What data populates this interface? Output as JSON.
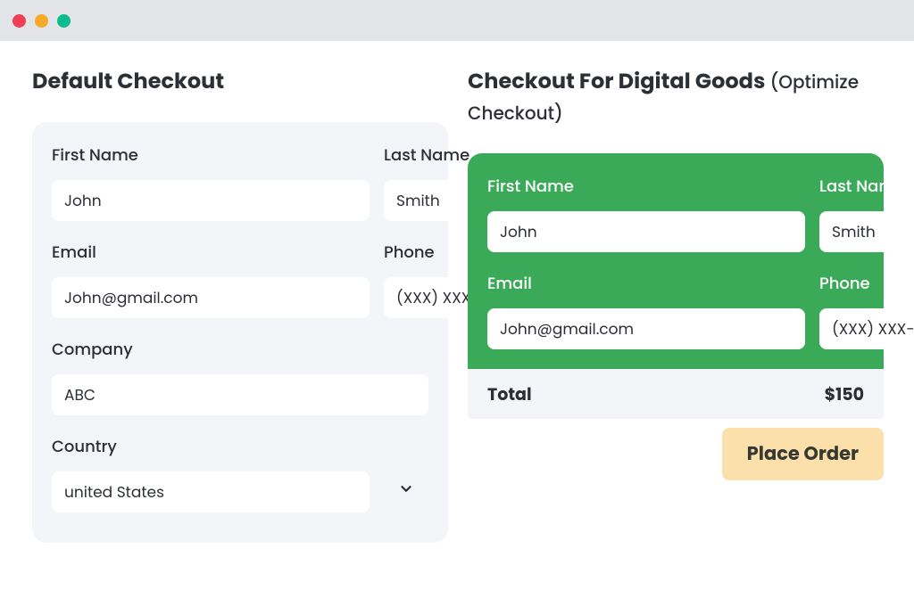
{
  "window": {
    "colors": {
      "red": "#f03e55",
      "yellow": "#f9a828",
      "green": "#0dbc8e"
    }
  },
  "left": {
    "title": "Default Checkout",
    "fields": {
      "first_name": {
        "label": "First Name",
        "value": "John"
      },
      "last_name": {
        "label": "Last Name",
        "value": "Smith"
      },
      "email": {
        "label": "Email",
        "value": "John@gmail.com"
      },
      "phone": {
        "label": "Phone",
        "placeholder": "(XXX) XXX-XXXX"
      },
      "company": {
        "label": "Company",
        "value": "ABC"
      },
      "country": {
        "label": "Country",
        "value": "united States"
      }
    }
  },
  "right": {
    "title_main": "Checkout For Digital Goods ",
    "title_sub": "(Optimize Checkout)",
    "fields": {
      "first_name": {
        "label": "First Name",
        "value": "John"
      },
      "last_name": {
        "label": "Last Name",
        "value": "Smith"
      },
      "email": {
        "label": "Email",
        "value": "John@gmail.com"
      },
      "phone": {
        "label": "Phone",
        "placeholder": "(XXX) XXX-XXXX"
      }
    },
    "total_label": "Total",
    "total_value": "$150",
    "cta": "Place Order"
  }
}
